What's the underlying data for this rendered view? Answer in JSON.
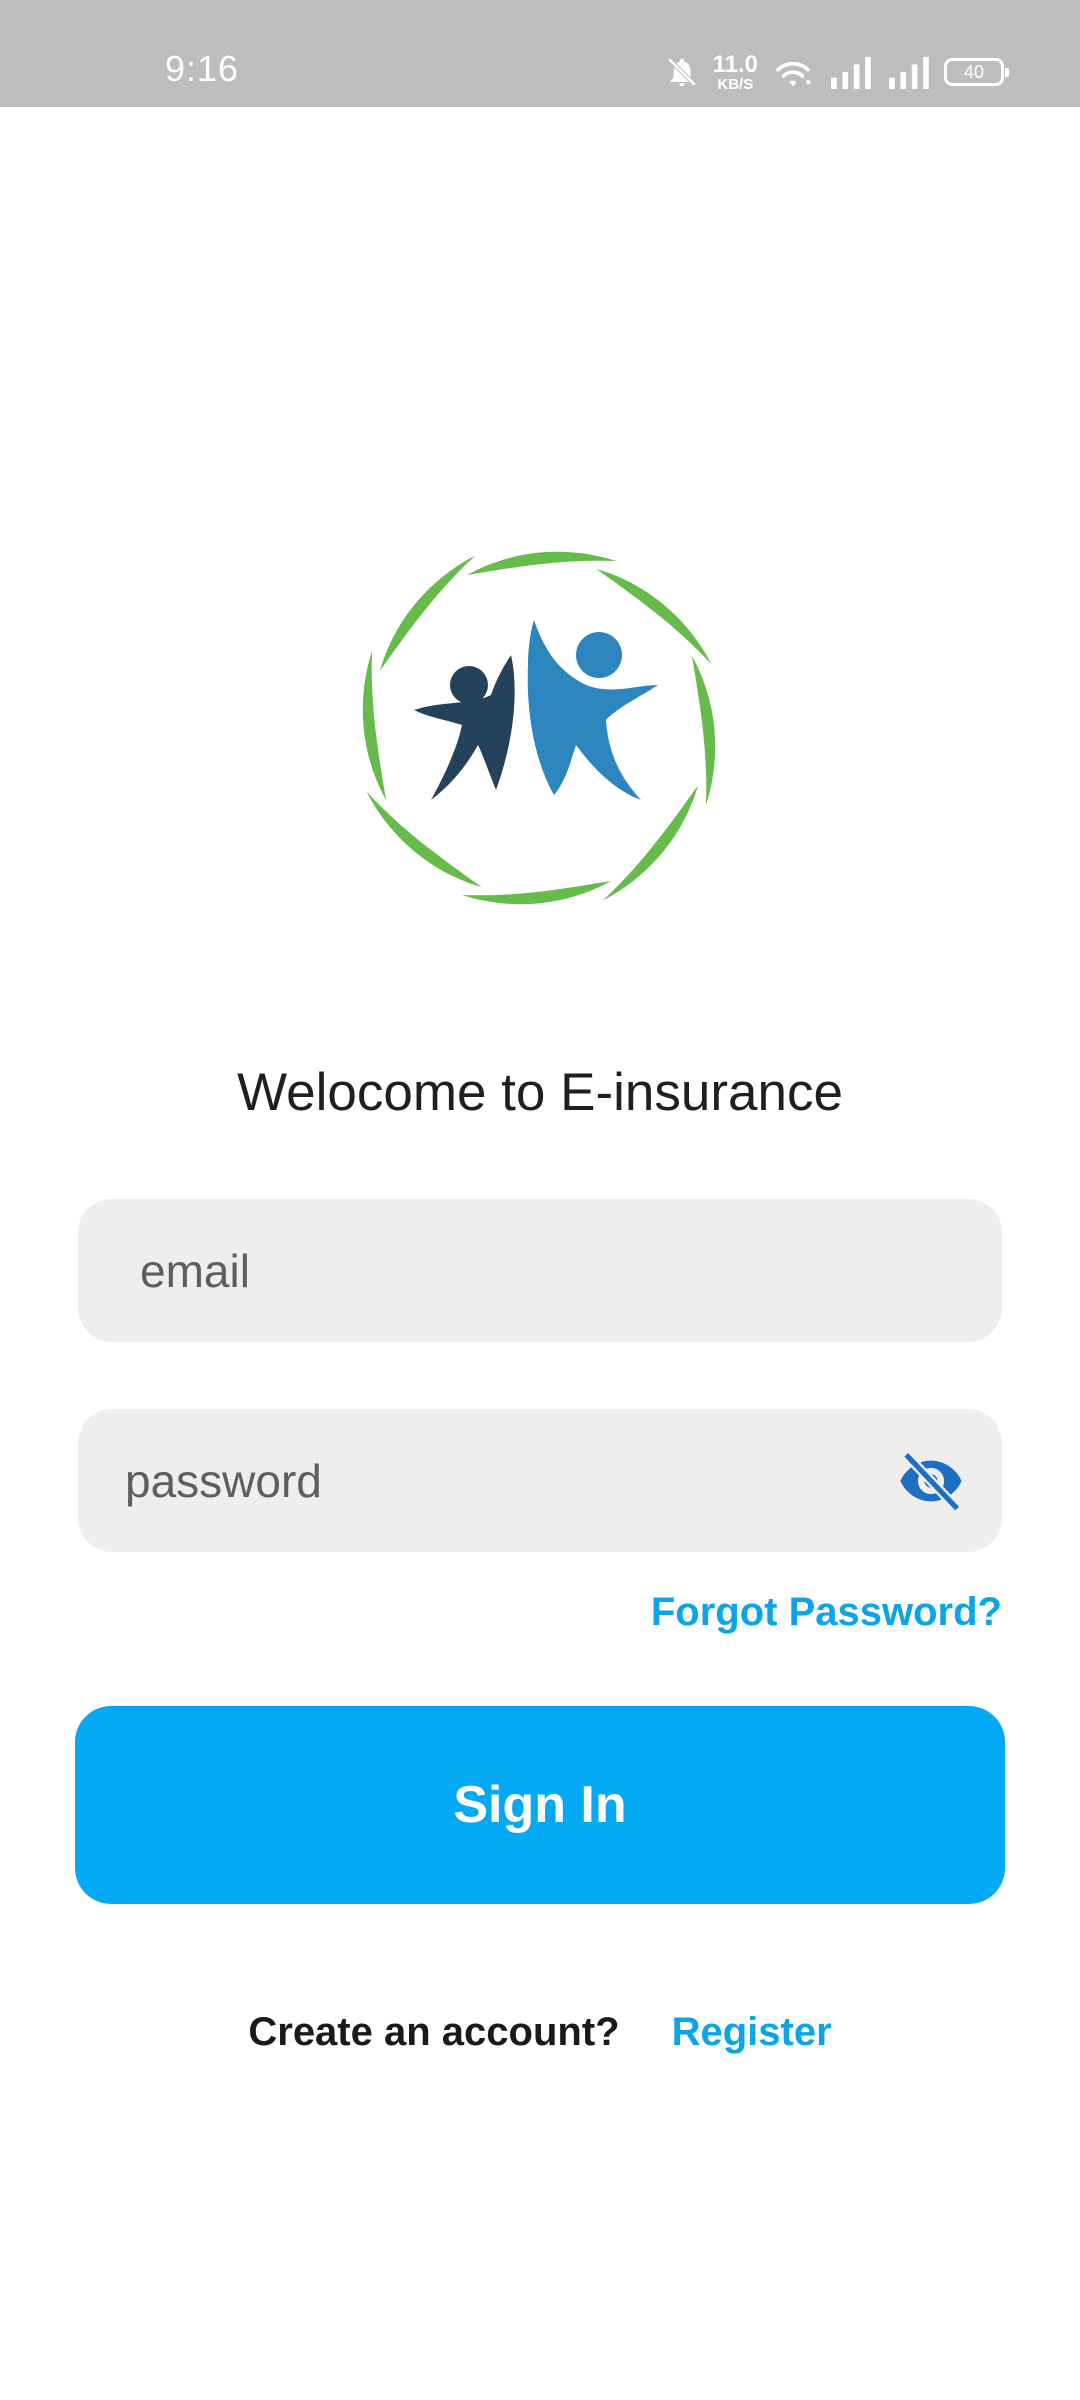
{
  "status_bar": {
    "time": "9:16",
    "net_speed_value": "11.0",
    "net_speed_unit": "KB/S",
    "battery": "40",
    "icons": [
      "bell-off-icon",
      "wifi-icon",
      "signal-icon",
      "signal-icon",
      "battery-icon"
    ]
  },
  "logo": {
    "icon": "people-in-leaf-circle-logo",
    "colors": {
      "leaf": "#66bb4a",
      "person_dark": "#24425a",
      "person_light": "#2c86bd"
    }
  },
  "welcome": {
    "title": "Welocome to E-insurance"
  },
  "form": {
    "email_placeholder": "email",
    "password_placeholder": "password",
    "password_visibility_icon": "eye-off-icon",
    "forgot_label": "Forgot Password?",
    "signin_label": "Sign In"
  },
  "footer": {
    "create_text": "Create an account?",
    "register_label": "Register"
  },
  "colors": {
    "accent": "#03a9f4",
    "link": "#0aa4ea",
    "field_bg": "#eeeeee",
    "status_bar_bg": "#bdbdbd"
  }
}
